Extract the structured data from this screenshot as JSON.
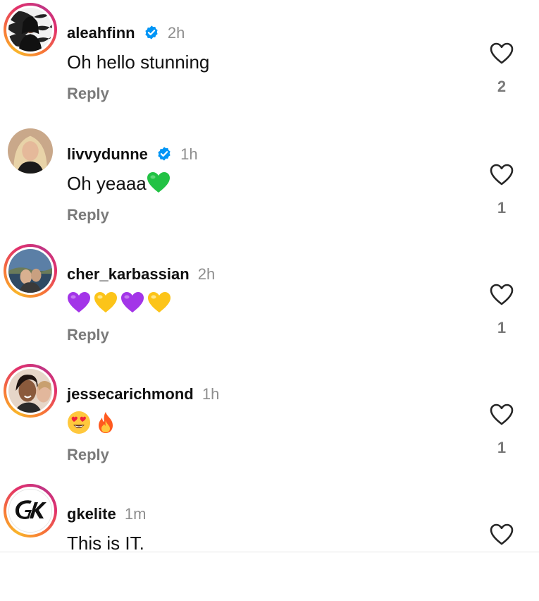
{
  "comments": [
    {
      "username": "aleahfinn",
      "verified": true,
      "time": "2h",
      "text": "Oh hello stunning",
      "reply_label": "Reply",
      "like_count": "2",
      "has_story": true
    },
    {
      "username": "livvydunne",
      "verified": true,
      "time": "1h",
      "text": "Oh yeaaa",
      "text_emoji": [
        "green-heart"
      ],
      "reply_label": "Reply",
      "like_count": "1",
      "has_story": false
    },
    {
      "username": "cher_karbassian",
      "verified": false,
      "time": "2h",
      "text": "",
      "text_emoji": [
        "purple-heart",
        "yellow-heart",
        "purple-heart",
        "yellow-heart"
      ],
      "reply_label": "Reply",
      "like_count": "1",
      "has_story": true
    },
    {
      "username": "jessecarichmond",
      "verified": false,
      "time": "1h",
      "text": "",
      "text_emoji": [
        "heart-eyes",
        "fire"
      ],
      "reply_label": "Reply",
      "like_count": "1",
      "has_story": true
    },
    {
      "username": "gkelite",
      "verified": false,
      "time": "1m",
      "text": "This is IT.",
      "reply_label": "Reply",
      "like_count": "",
      "has_story": true,
      "avatar_logo": "GK"
    }
  ],
  "colors": {
    "verified_blue": "#0095f6",
    "secondary_text": "#8e8e8e",
    "primary_text": "#111111"
  }
}
